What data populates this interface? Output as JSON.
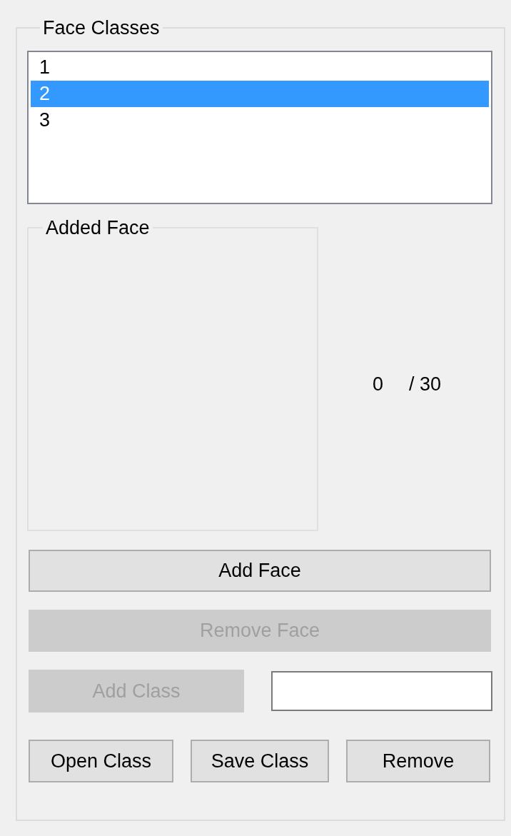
{
  "face_classes": {
    "title": "Face Classes",
    "items": [
      {
        "label": "1",
        "selected": false
      },
      {
        "label": "2",
        "selected": true
      },
      {
        "label": "3",
        "selected": false
      }
    ]
  },
  "added_face": {
    "title": "Added Face"
  },
  "counter": {
    "count": "0",
    "total": "/ 30"
  },
  "wide_buttons": [
    {
      "label": "Add Face",
      "disabled": false
    },
    {
      "label": "Remove Face",
      "disabled": true
    }
  ],
  "add_class": {
    "label": "Add Class",
    "disabled": true
  },
  "bottom_buttons": [
    {
      "label": "Open Class",
      "disabled": false
    },
    {
      "label": "Save Class",
      "disabled": false
    },
    {
      "label": "Remove",
      "disabled": false
    }
  ]
}
